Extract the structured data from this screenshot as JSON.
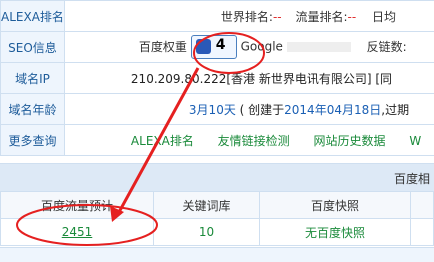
{
  "info_rows": {
    "alexa": {
      "label": "ALEXA排名",
      "world_rank_label": "世界排名:",
      "world_rank": "--",
      "traffic_rank_label": "流量排名:",
      "traffic_rank": "--",
      "daily_label": "日均"
    },
    "seo": {
      "label": "SEO信息",
      "baidu_weight_label": "百度权重",
      "baidu_weight": "4",
      "google_label": "Google",
      "backlinks_label": "反链数:"
    },
    "ip": {
      "label": "域名IP",
      "value": "210.209.80.222[香港 新世界电讯有限公司]",
      "extra": "[同"
    },
    "age": {
      "label": "域名年龄",
      "months": "3月10天",
      "created_prefix": "( 创建于",
      "created_date": "2014年04月18日",
      "expire_prefix": ",过期"
    },
    "more": {
      "label": "更多查询",
      "links": [
        "ALEXA排名",
        "友情链接检测",
        "网站历史数据",
        "W"
      ]
    }
  },
  "section_title": "百度相",
  "stats_table": {
    "headers": [
      "百度流量预计",
      "关键词库",
      "百度快照"
    ],
    "values": [
      "2451",
      "10",
      "无百度快照"
    ]
  },
  "footer_text": "",
  "colors": {
    "label_bg": "#eef5fd",
    "label_text": "#1e5c9a",
    "accent_red": "#e03030",
    "link_green": "#1a8a3a",
    "border": "#cfdff0"
  }
}
